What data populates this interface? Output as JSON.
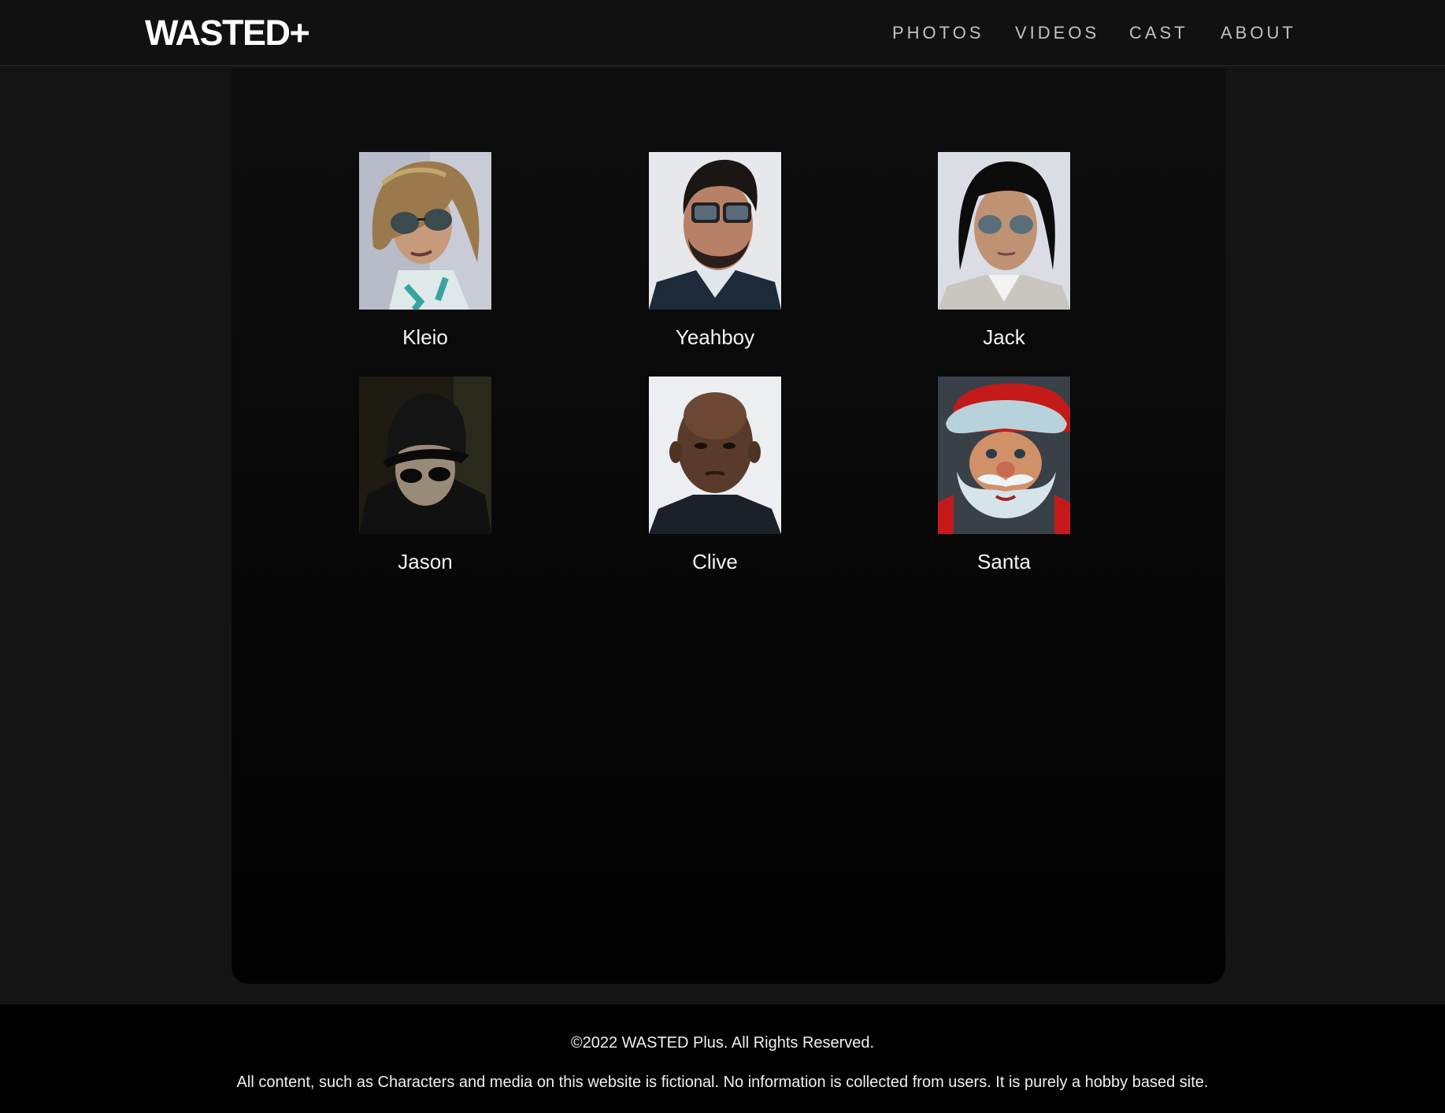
{
  "brand": {
    "logo": "WASTED+"
  },
  "nav": [
    {
      "label": "PHOTOS"
    },
    {
      "label": "VIDEOS"
    },
    {
      "label": "CAST"
    },
    {
      "label": "ABOUT"
    }
  ],
  "cast": [
    {
      "name": "Kleio"
    },
    {
      "name": "Yeahboy"
    },
    {
      "name": "Jack"
    },
    {
      "name": "Jason"
    },
    {
      "name": "Clive"
    },
    {
      "name": "Santa"
    }
  ],
  "footer": {
    "copyright": "©2022 WASTED Plus. All Rights Reserved.",
    "disclaimer": "All content, such as Characters and media on this website is fictional. No information is collected from users. It is purely a hobby based site."
  },
  "colors": {
    "background": "#141414",
    "header": "#111111",
    "footer": "#000000",
    "nav_text": "#c2c2c2"
  }
}
